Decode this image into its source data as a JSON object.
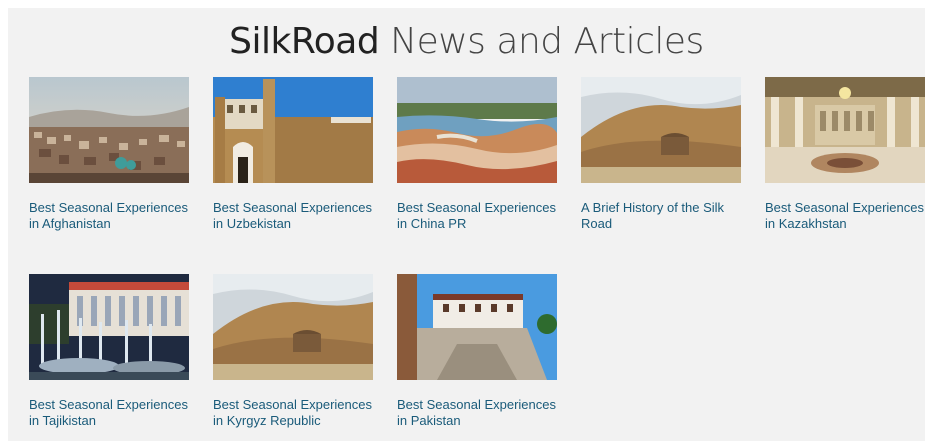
{
  "header": {
    "brand": "SilkRoad",
    "rest": " News and Articles"
  },
  "articles": [
    {
      "title": "Best Seasonal Experiences in Afghanistan",
      "image": "kabul-cityscape"
    },
    {
      "title": "Best Seasonal Experiences in Uzbekistan",
      "image": "khiva-fortress-walls"
    },
    {
      "title": "Best Seasonal Experiences in China PR",
      "image": "colorful-rock-landscape"
    },
    {
      "title": "A Brief History of the Silk Road",
      "image": "desert-caravanserai"
    },
    {
      "title": "Best Seasonal Experiences in Kazakhstan",
      "image": "palace-hall-interior"
    },
    {
      "title": "Best Seasonal Experiences in Tajikistan",
      "image": "palace-fountains-night"
    },
    {
      "title": "Best Seasonal Experiences in Kyrgyz Republic",
      "image": "desert-caravanserai"
    },
    {
      "title": "Best Seasonal Experiences in Pakistan",
      "image": "hillside-fort"
    }
  ]
}
